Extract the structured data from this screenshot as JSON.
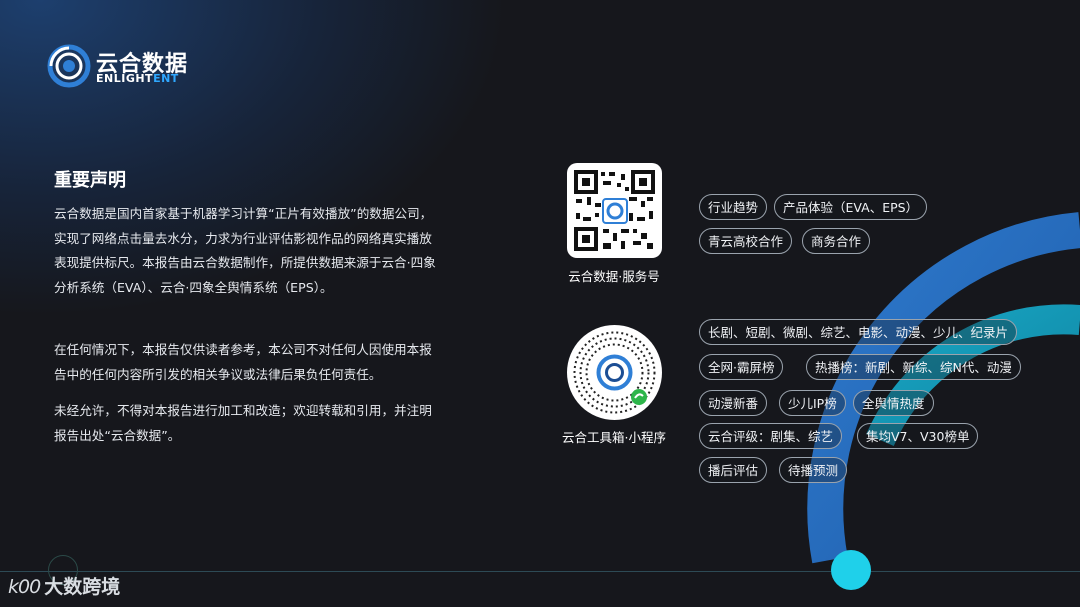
{
  "brand": {
    "name_cn": "云合数据",
    "name_en_main": "ENLIGHT",
    "name_en_accent": "ENT"
  },
  "declaration": {
    "title": "重要声明",
    "paragraphs": [
      "云合数据是国内首家基于机器学习计算“正片有效播放”的数据公司，实现了网络点击量去水分，力求为行业评估影视作品的网络真实播放表现提供标尺。本报告由云合数据制作，所提供数据来源于云合·四象分析系统（EVA）、云合·四象全舆情系统（EPS）。",
      "在任何情况下，本报告仅供读者参考，本公司不对任何人因使用本报告中的任何内容所引发的相关争议或法律后果负任何责任。",
      "未经允许，不得对本报告进行加工和改造；欢迎转载和引用，并注明报告出处“云合数据”。"
    ]
  },
  "service_account": {
    "label": "云合数据·服务号",
    "tags": [
      "行业趋势",
      "产品体验（EVA、EPS）",
      "青云高校合作",
      "商务合作"
    ]
  },
  "mini_program": {
    "label": "云合工具箱·小程序",
    "tags": [
      "长剧、短剧、微剧、综艺、电影、动漫、少儿、纪录片",
      "全网·霸屏榜",
      "热播榜：新剧、新综、综N代、动漫",
      "动漫新番",
      "少儿IP榜",
      "全舆情热度",
      "云合评级：剧集、综艺",
      "集均V7、V30榜单",
      "播后评估",
      "待播预测"
    ]
  },
  "watermark": {
    "icon": "k00",
    "text": "大数跨境"
  },
  "icons": [
    "enlightent-logo-icon",
    "qr-code-icon",
    "mini-program-code-icon",
    "arc-decoration"
  ],
  "colors": {
    "accent_blue": "#2f7fd6",
    "accent_cyan": "#1fd0ea",
    "background": "#16171c"
  }
}
